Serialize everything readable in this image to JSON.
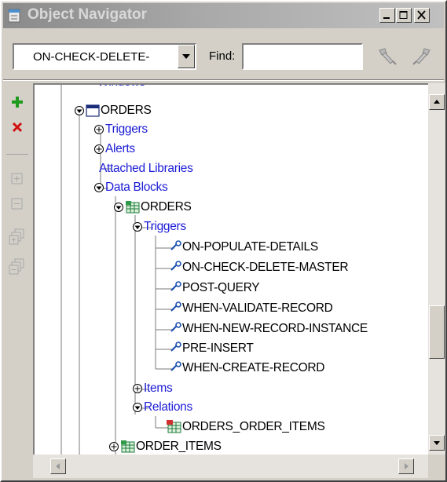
{
  "window": {
    "title": "Object Navigator",
    "title_icon": "object-navigator-icon",
    "buttons": [
      "minimize",
      "maximize",
      "close"
    ]
  },
  "toolbar": {
    "selector_value": "ON-CHECK-DELETE-",
    "find_label": "Find:",
    "find_value": "",
    "find_previous_icon": "flashlight-search-back-icon",
    "find_next_icon": "flashlight-search-forward-icon"
  },
  "side_toolbar": {
    "items": [
      {
        "name": "create-icon",
        "color": "#1f9a1f",
        "enabled": true
      },
      {
        "name": "delete-icon",
        "color": "#d01010",
        "enabled": true
      },
      {
        "name": "expand-icon",
        "enabled": false
      },
      {
        "name": "collapse-icon",
        "enabled": false
      },
      {
        "name": "expand-all-icon",
        "enabled": false
      },
      {
        "name": "collapse-all-icon",
        "enabled": false
      }
    ]
  },
  "tree": {
    "partial_top": "Windows",
    "nodes": [
      {
        "label": "ORDERS",
        "kind": "form",
        "color": "black",
        "toggle": "expanded"
      },
      {
        "label": "Triggers",
        "kind": "category",
        "color": "blue",
        "toggle": "collapsed"
      },
      {
        "label": "Alerts",
        "kind": "category",
        "color": "blue",
        "toggle": "collapsed"
      },
      {
        "label": "Attached Libraries",
        "kind": "category",
        "color": "blue",
        "toggle": "none"
      },
      {
        "label": "Data Blocks",
        "kind": "category",
        "color": "blue",
        "toggle": "expanded"
      },
      {
        "label": "ORDERS",
        "kind": "block",
        "color": "black",
        "toggle": "expanded"
      },
      {
        "label": "Triggers",
        "kind": "category",
        "color": "blue",
        "toggle": "expanded"
      },
      {
        "label": "ON-POPULATE-DETAILS",
        "kind": "trigger",
        "color": "black",
        "toggle": "none"
      },
      {
        "label": "ON-CHECK-DELETE-MASTER",
        "kind": "trigger",
        "color": "black",
        "toggle": "none"
      },
      {
        "label": "POST-QUERY",
        "kind": "trigger",
        "color": "black",
        "toggle": "none"
      },
      {
        "label": "WHEN-VALIDATE-RECORD",
        "kind": "trigger",
        "color": "black",
        "toggle": "none"
      },
      {
        "label": "WHEN-NEW-RECORD-INSTANCE",
        "kind": "trigger",
        "color": "black",
        "toggle": "none"
      },
      {
        "label": "PRE-INSERT",
        "kind": "trigger",
        "color": "black",
        "toggle": "none"
      },
      {
        "label": "WHEN-CREATE-RECORD",
        "kind": "trigger",
        "color": "black",
        "toggle": "none"
      },
      {
        "label": "Items",
        "kind": "category",
        "color": "blue",
        "toggle": "collapsed"
      },
      {
        "label": "Relations",
        "kind": "category",
        "color": "blue",
        "toggle": "expanded"
      },
      {
        "label": "ORDERS_ORDER_ITEMS",
        "kind": "relation",
        "color": "black",
        "toggle": "none"
      },
      {
        "label": "ORDER_ITEMS",
        "kind": "block",
        "color": "black",
        "toggle": "collapsed"
      }
    ]
  },
  "scrollbars": {
    "vertical_position": 0.72,
    "horizontal_position": 0.0
  }
}
